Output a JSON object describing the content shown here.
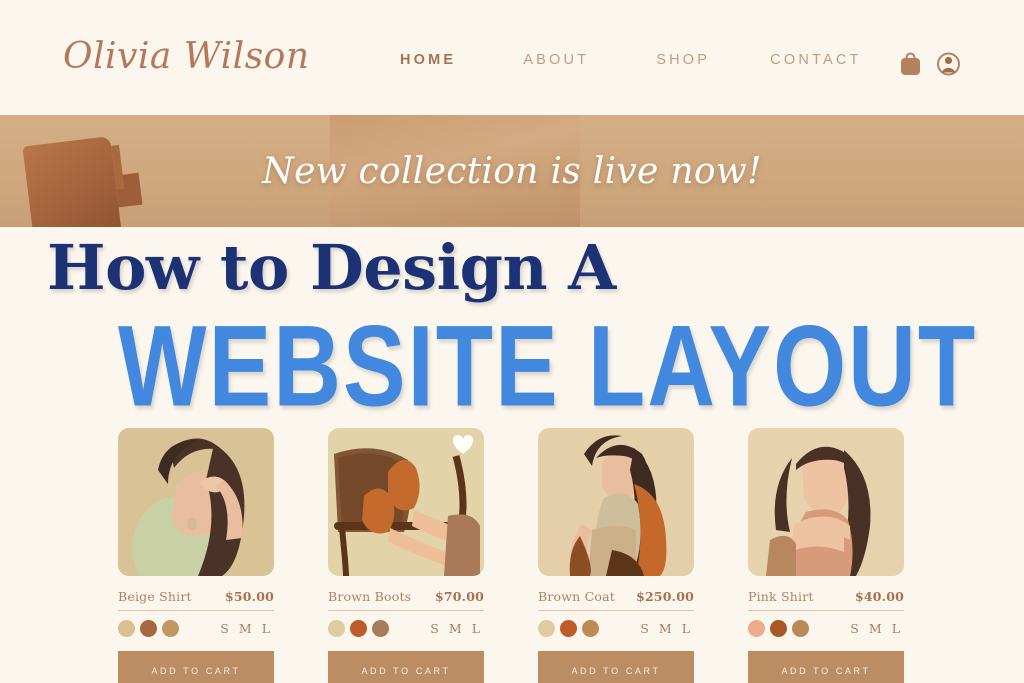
{
  "brand": {
    "logo": "Olivia Wilson"
  },
  "nav": {
    "items": [
      {
        "label": "HOME",
        "active": true
      },
      {
        "label": "ABOUT",
        "active": false
      },
      {
        "label": "SHOP",
        "active": false
      },
      {
        "label": "CONTACT",
        "active": false
      }
    ],
    "icons": [
      {
        "name": "shopping-bag-icon"
      },
      {
        "name": "user-account-icon"
      }
    ]
  },
  "banner": {
    "text": "New collection is live now!"
  },
  "headline": {
    "line1": "How to Design A",
    "line2": "WEBSITE LAYOUT",
    "line1_color": "#1C3274",
    "line2_color": "#4188DE"
  },
  "products": [
    {
      "title": "Beige Shirt",
      "price": "$50.00",
      "favorited": false,
      "swatches": [
        "#D9C091",
        "#A5683F",
        "#C39763"
      ],
      "sizes": [
        "S",
        "M",
        "L"
      ],
      "cta": "ADD TO CART"
    },
    {
      "title": "Brown Boots",
      "price": "$70.00",
      "favorited": true,
      "swatches": [
        "#DFCCA1",
        "#BC5C2B",
        "#A87B5A"
      ],
      "sizes": [
        "S",
        "M",
        "L"
      ],
      "cta": "ADD TO CART"
    },
    {
      "title": "Brown Coat",
      "price": "$250.00",
      "favorited": false,
      "swatches": [
        "#DFCCA1",
        "#BD5C29",
        "#BE8C52"
      ],
      "sizes": [
        "S",
        "M",
        "L"
      ],
      "cta": "ADD TO CART"
    },
    {
      "title": "Pink Shirt",
      "price": "$40.00",
      "favorited": false,
      "swatches": [
        "#EDAC8C",
        "#A85A25",
        "#BA8B56"
      ],
      "sizes": [
        "S",
        "M",
        "L"
      ],
      "cta": "ADD TO CART"
    }
  ],
  "theme": {
    "page_background": "#FBF6EE",
    "banner_background": "#CFA87E",
    "accent_brown": "#B5795A",
    "button_background": "#BC8D62"
  }
}
